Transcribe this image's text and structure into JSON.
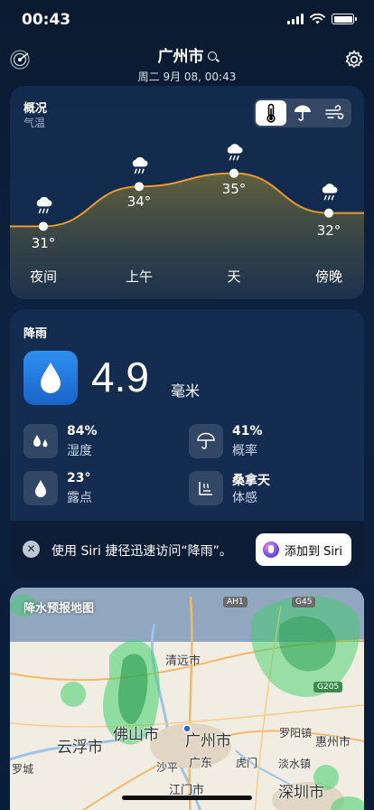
{
  "status_bar": {
    "time": "00:43"
  },
  "header": {
    "city": "广州市",
    "date": "周二 9月 08, 00:43",
    "icons": [
      "radar-icon",
      "search-icon",
      "gear-icon"
    ]
  },
  "overview": {
    "title": "概况",
    "subtitle": "气温",
    "toggle_options": [
      "thermometer-icon",
      "umbrella-icon",
      "wind-icon"
    ],
    "selected_toggle": "thermometer-icon"
  },
  "chart_data": {
    "type": "line",
    "categories": [
      "夜间",
      "上午",
      "天",
      "傍晚"
    ],
    "values": [
      31,
      34,
      35,
      32
    ],
    "value_labels": [
      "31°",
      "34°",
      "35°",
      "32°"
    ],
    "weather_icons": [
      "rain-cloud-icon",
      "rain-cloud-icon",
      "rain-cloud-icon",
      "rain-cloud-icon"
    ],
    "title": "",
    "xlabel": "",
    "ylabel": "",
    "colors": {
      "line": "#e89a2e"
    }
  },
  "precip": {
    "title": "降雨",
    "value": "4.9",
    "unit": "毫米",
    "metrics": [
      {
        "icon": "humidity-icon",
        "value": "84%",
        "label": "湿度"
      },
      {
        "icon": "umbrella-icon",
        "value": "41%",
        "label": "概率"
      },
      {
        "icon": "dewpoint-drop-icon",
        "value": "23°",
        "label": "露点"
      },
      {
        "icon": "sauna-icon",
        "value": "桑拿天",
        "label": "体感"
      }
    ],
    "siri_prompt": "使用 Siri 捷径迅速访问“降雨”。",
    "siri_button": "添加到 Siri"
  },
  "map": {
    "title": "降水预报地图",
    "labels": [
      "清远市",
      "佛山市",
      "广州市",
      "云浮市",
      "罗阳镇",
      "惠州市",
      "广东",
      "沙平",
      "江门市",
      "深圳市",
      "淡水镇",
      "虎门",
      "罗城"
    ],
    "shields": [
      "AH1",
      "G45",
      "G205"
    ]
  }
}
